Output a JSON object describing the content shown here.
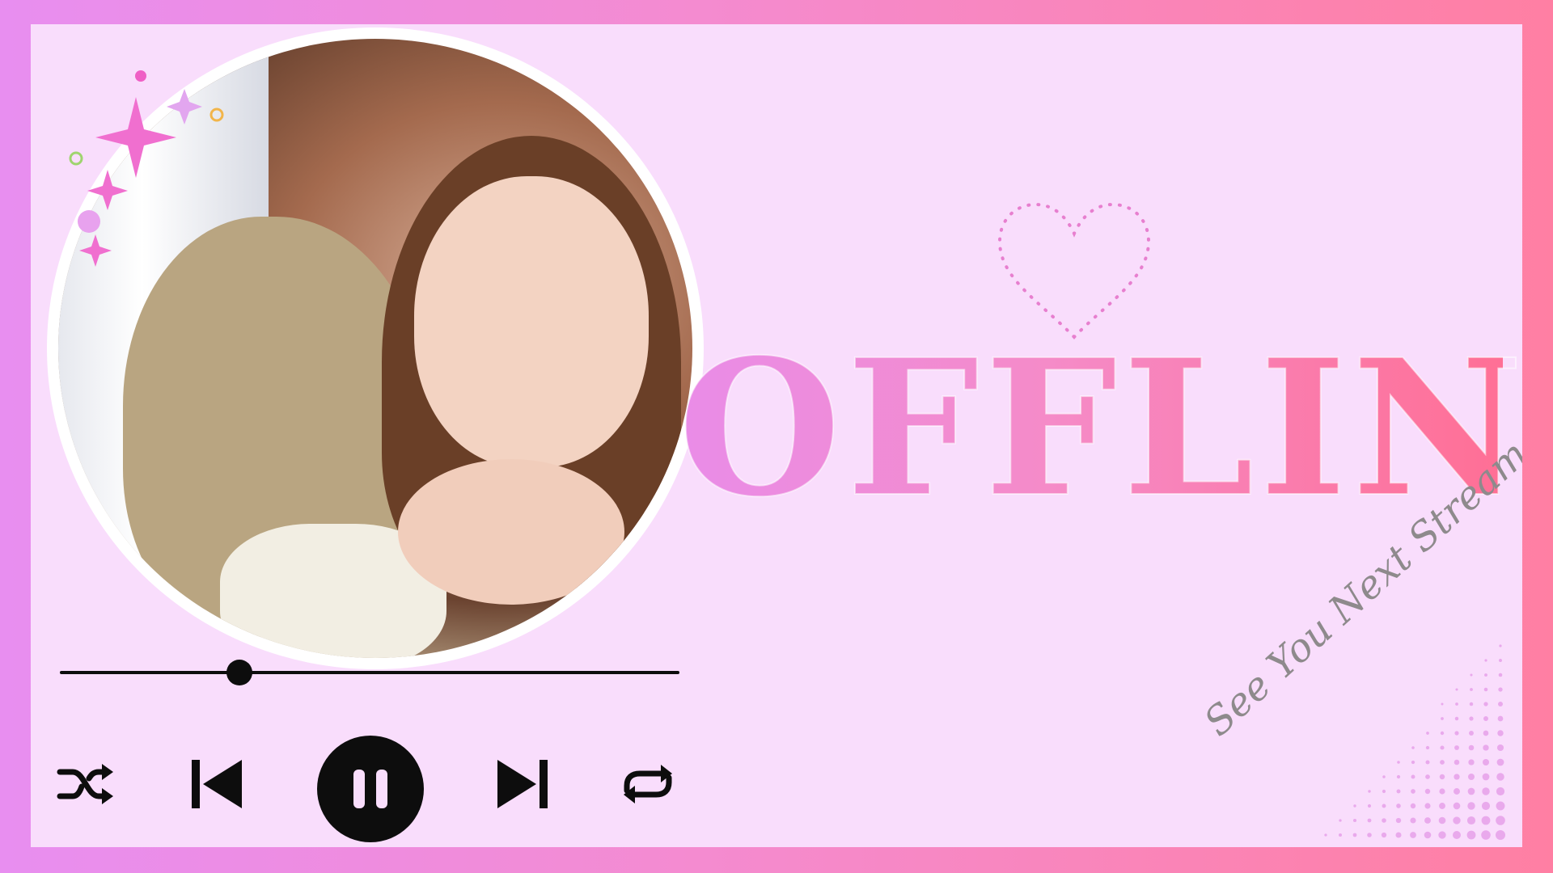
{
  "scene": {
    "status_text": "OFFLINE",
    "tagline": "See You Next Stream"
  },
  "player": {
    "progress": 0.29,
    "state": "playing",
    "controls": [
      "shuffle-icon",
      "previous-icon",
      "pause-icon",
      "next-icon",
      "repeat-icon"
    ]
  },
  "colors": {
    "frame_left": "#e88ef0",
    "frame_right": "#ff7fa3",
    "panel": "#f9ddfc",
    "controls": "#0d0d0d",
    "tagline": "#8e8a8c"
  }
}
